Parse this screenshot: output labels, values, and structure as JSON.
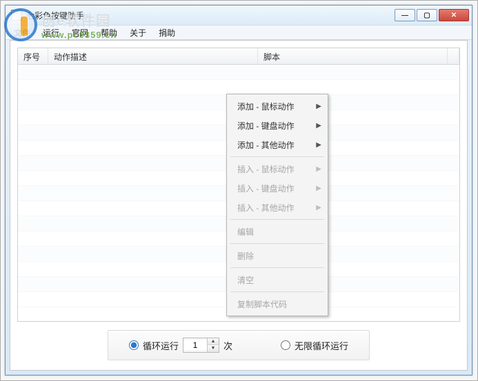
{
  "window": {
    "title": "七彩色按键助手"
  },
  "menubar": {
    "items": [
      {
        "label": "文件"
      },
      {
        "label": "运行"
      },
      {
        "label": "官网"
      },
      {
        "label": "帮助"
      },
      {
        "label": "关于"
      },
      {
        "label": "捐助"
      }
    ]
  },
  "watermark": {
    "line1": "创e软件园",
    "line2": "www.pc0359.cn"
  },
  "table": {
    "columns": {
      "seq": "序号",
      "desc": "动作描述",
      "script": "脚本"
    }
  },
  "context_menu": {
    "items": [
      {
        "label": "添加 - 鼠标动作",
        "sub": true,
        "enabled": true
      },
      {
        "label": "添加 - 键盘动作",
        "sub": true,
        "enabled": true
      },
      {
        "label": "添加 - 其他动作",
        "sub": true,
        "enabled": true
      },
      {
        "sep": true
      },
      {
        "label": "插入 - 鼠标动作",
        "sub": true,
        "enabled": false
      },
      {
        "label": "插入 - 键盘动作",
        "sub": true,
        "enabled": false
      },
      {
        "label": "插入 - 其他动作",
        "sub": true,
        "enabled": false
      },
      {
        "sep": true
      },
      {
        "label": "编辑",
        "enabled": false
      },
      {
        "sep": true
      },
      {
        "label": "删除",
        "enabled": false
      },
      {
        "sep": true
      },
      {
        "label": "清空",
        "enabled": false
      },
      {
        "sep": true
      },
      {
        "label": "复制脚本代码",
        "enabled": false
      }
    ]
  },
  "footer": {
    "loop_label": "循环运行",
    "loop_count": "1",
    "loop_unit": "次",
    "infinite_label": "无限循环运行",
    "selected": "loop"
  }
}
